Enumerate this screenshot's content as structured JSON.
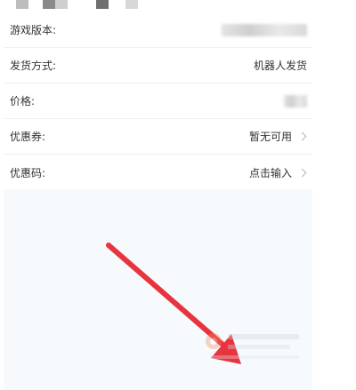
{
  "order_form": {
    "rows": [
      {
        "label": "游戏版本:",
        "value": ""
      },
      {
        "label": "发货方式:",
        "value": "机器人发货"
      },
      {
        "label": "价格:",
        "value": ""
      },
      {
        "label": "优惠券:",
        "value": "暂无可用"
      },
      {
        "label": "优惠码:",
        "value": "点击输入"
      }
    ]
  },
  "colors": {
    "annotation_arrow": "#e8343f",
    "empty_area_bg": "#f6fafd",
    "divider": "#f0f0f0"
  },
  "icons": [
    "chevron-right-icon"
  ]
}
